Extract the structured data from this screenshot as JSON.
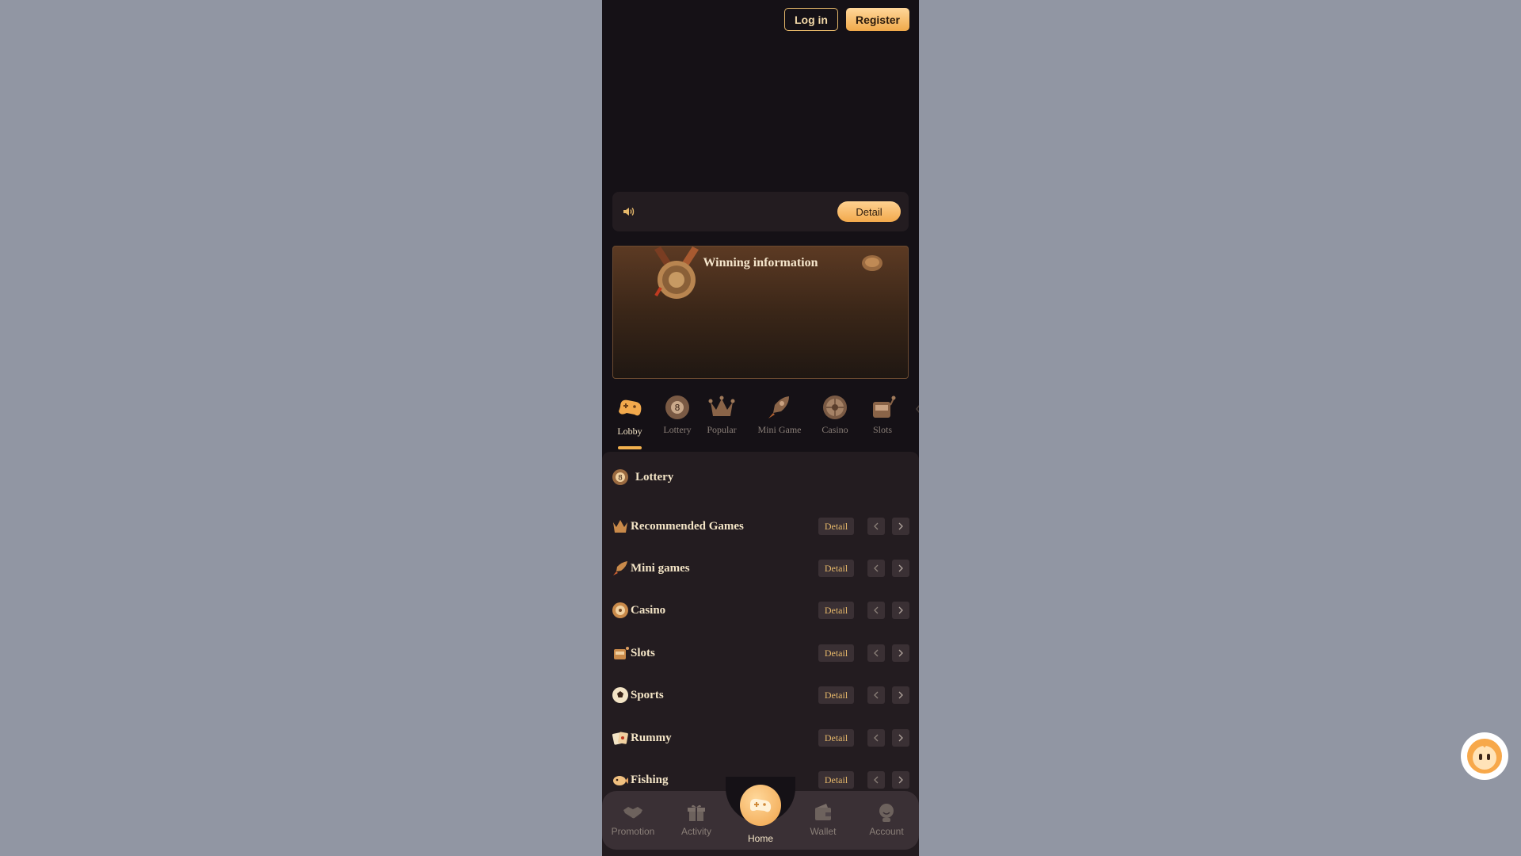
{
  "header": {
    "login_label": "Log in",
    "register_label": "Register"
  },
  "notice": {
    "detail_label": "Detail"
  },
  "winning": {
    "title": "Winning information"
  },
  "tabs": [
    {
      "label": "Lobby",
      "icon": "gamepad-icon",
      "active": true
    },
    {
      "label": "Lottery",
      "icon": "lottery-ball-icon"
    },
    {
      "label": "Popular",
      "icon": "crown-icon"
    },
    {
      "label": "Mini Game",
      "icon": "rocket-icon"
    },
    {
      "label": "Casino",
      "icon": "roulette-icon"
    },
    {
      "label": "Slots",
      "icon": "slot-machine-icon"
    }
  ],
  "sections": {
    "lottery": {
      "title": "Lottery"
    },
    "items": [
      {
        "title": "Recommended Games",
        "detail": "Detail"
      },
      {
        "title": "Mini games",
        "detail": "Detail"
      },
      {
        "title": "Casino",
        "detail": "Detail"
      },
      {
        "title": "Slots",
        "detail": "Detail"
      },
      {
        "title": "Sports",
        "detail": "Detail"
      },
      {
        "title": "Rummy",
        "detail": "Detail"
      },
      {
        "title": "Fishing",
        "detail": "Detail"
      }
    ]
  },
  "nav": {
    "promotion": "Promotion",
    "activity": "Activity",
    "home": "Home",
    "wallet": "Wallet",
    "account": "Account"
  },
  "colors": {
    "accent": "#f2b14f",
    "background": "#151116",
    "panel": "#231c20",
    "page_bg": "#9196a3"
  }
}
